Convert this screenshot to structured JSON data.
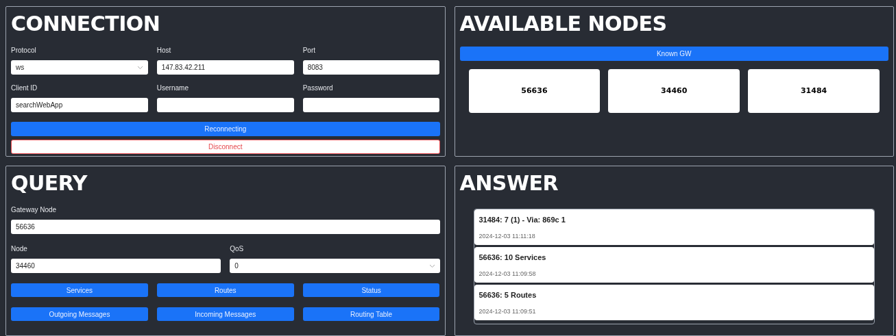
{
  "connection": {
    "title": "CONNECTION",
    "fields": [
      {
        "label": "Protocol",
        "kind": "select",
        "value": "ws"
      },
      {
        "label": "Host",
        "kind": "text",
        "value": "147.83.42.211"
      },
      {
        "label": "Port",
        "kind": "text",
        "value": "8083"
      },
      {
        "label": "Client ID",
        "kind": "text",
        "value": "searchWebApp"
      },
      {
        "label": "Username",
        "kind": "text"
      },
      {
        "label": "Password",
        "kind": "text"
      }
    ],
    "buttons": [
      {
        "label": "Reconnecting",
        "kind": "primary"
      },
      {
        "label": "Disconnect",
        "kind": "danger"
      }
    ]
  },
  "available_nodes": {
    "title": "AVAILABLE NODES",
    "button": "Known GW",
    "nodes": [
      "56636",
      "34460",
      "31484"
    ]
  },
  "query": {
    "title": "QUERY",
    "gateway": {
      "label": "Gateway Node",
      "kind": "text",
      "value": "56636"
    },
    "fields": [
      {
        "label": "Node",
        "kind": "text",
        "value": "34460"
      },
      {
        "label": "QoS",
        "kind": "select",
        "value": "0"
      }
    ],
    "buttons": [
      "Services",
      "Routes",
      "Status",
      "Outgoing Messages",
      "Incoming Messages",
      "Routing Table"
    ]
  },
  "answer": {
    "title": "ANSWER",
    "items": [
      {
        "title": "31484: 7 (1) - Via: 869c 1",
        "time": "2024-12-03 11:11:18"
      },
      {
        "title": "56636: 10 Services",
        "time": "2024-12-03 11:09:58"
      },
      {
        "title": "56636: 5 Routes",
        "time": "2024-12-03 11:09:51"
      }
    ]
  }
}
